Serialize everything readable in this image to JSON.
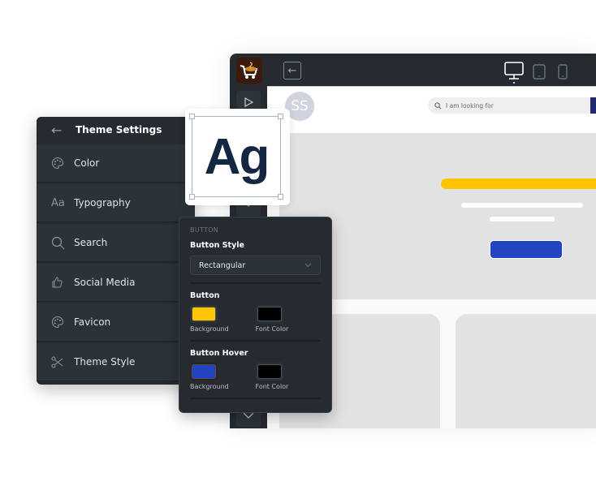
{
  "editor": {
    "logo_icon": "shopping-cart-coffee-logo",
    "back_icon": "arrow-left-icon",
    "devices": [
      {
        "name": "desktop",
        "icon": "monitor-icon",
        "active": true
      },
      {
        "name": "tablet",
        "icon": "tablet-icon",
        "active": false
      },
      {
        "name": "mobile",
        "icon": "smartphone-icon",
        "active": false
      }
    ],
    "rail_icons": [
      "play-icon",
      "chevron-down-icon",
      "chevron-down-icon"
    ],
    "preview": {
      "avatar_initials": "SS",
      "search_placeholder": "I am looking for",
      "colors": {
        "accent_yellow": "#ffc400",
        "button_blue": "#2244c2",
        "search_button": "#1e2a6b"
      }
    }
  },
  "theme_settings": {
    "title": "Theme Settings",
    "items": [
      {
        "label": "Color",
        "icon": "palette-icon"
      },
      {
        "label": "Typography",
        "icon": "typography-icon"
      },
      {
        "label": "Search",
        "icon": "search-icon"
      },
      {
        "label": "Social Media",
        "icon": "thumbs-up-icon"
      },
      {
        "label": "Favicon",
        "icon": "palette-icon"
      },
      {
        "label": "Theme Style",
        "icon": "scissors-icon"
      }
    ]
  },
  "typography_preview": {
    "sample": "Ag"
  },
  "button_panel": {
    "section_label": "BUTTON",
    "style_title": "Button Style",
    "style_value": "Rectangular",
    "button_title": "Button",
    "button_swatches": [
      {
        "label": "Background",
        "color": "#ffc400"
      },
      {
        "label": "Font Color",
        "color": "#000000"
      }
    ],
    "hover_title": "Button Hover",
    "hover_swatches": [
      {
        "label": "Background",
        "color": "#2244c2"
      },
      {
        "label": "Font Color",
        "color": "#000000"
      }
    ]
  }
}
